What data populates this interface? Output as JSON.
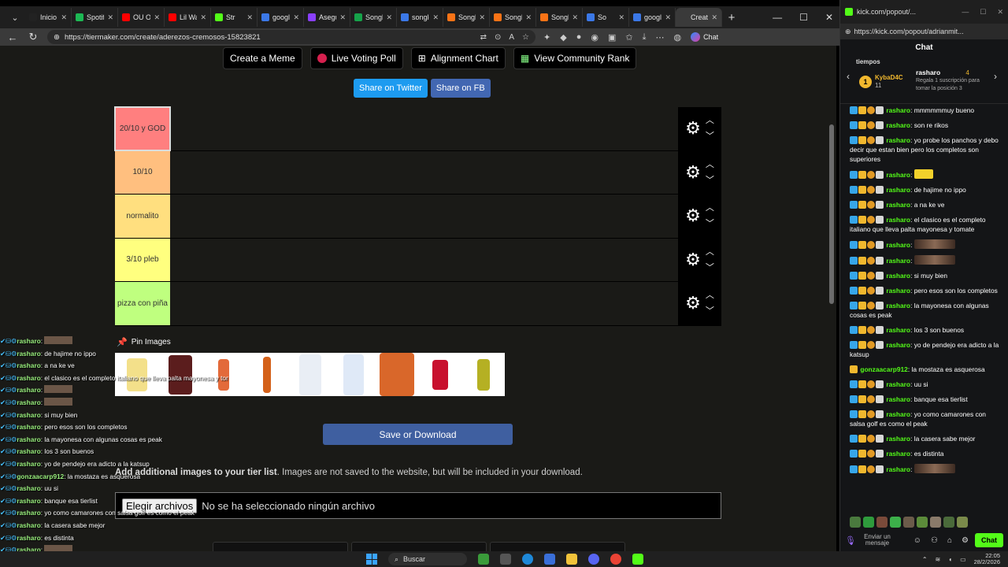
{
  "browser": {
    "tabs": [
      {
        "title": "Inicio /",
        "color": "#222222"
      },
      {
        "title": "Spotify",
        "color": "#1db954"
      },
      {
        "title": "OU OU",
        "color": "#ff0000"
      },
      {
        "title": "Lil Way",
        "color": "#ff0000"
      },
      {
        "title": "Str",
        "color": "#53fc18"
      },
      {
        "title": "google",
        "color": "#3b78e7"
      },
      {
        "title": "Asegur",
        "color": "#8a3ffc"
      },
      {
        "title": "Songle",
        "color": "#16a34a"
      },
      {
        "title": "songle",
        "color": "#3b78e7"
      },
      {
        "title": "Songle",
        "color": "#f97316"
      },
      {
        "title": "Songle",
        "color": "#f97316"
      },
      {
        "title": "Songle",
        "color": "#f97316"
      },
      {
        "title": "So",
        "color": "#3b78e7"
      },
      {
        "title": "google",
        "color": "#3b78e7"
      },
      {
        "title": "Create",
        "color": "#3a3a3a"
      }
    ],
    "url": "https://tiermaker.com/create/aderezos-cremosos-15823821",
    "copilot_label": "Chat"
  },
  "tiermaker": {
    "buttons": [
      "Create a Meme",
      "Live Voting Poll",
      "Alignment Chart",
      "View Community Rank"
    ],
    "share_twitter": "Share on Twitter",
    "share_fb": "Share on FB",
    "tiers": [
      {
        "label": "20/10 y GOD",
        "color": "#ff7f7f"
      },
      {
        "label": "10/10",
        "color": "#ffbf7f"
      },
      {
        "label": "normalito",
        "color": "#ffdf7f"
      },
      {
        "label": "3/10 pleb",
        "color": "#ffff7f"
      },
      {
        "label": "pizza con piña",
        "color": "#bfff7f"
      }
    ],
    "pin_images_label": "Pin Images",
    "save_button": "Save or Download",
    "add_note_bold": "Add additional images to your tier list",
    "add_note_rest": ". Images are not saved to the website, but will be included in your download.",
    "file_button": "Elegir archivos",
    "file_status": "No se ha seleccionado ningún archivo"
  },
  "overlay_chat": [
    {
      "user": "rasharo",
      "text": ""
    },
    {
      "user": "rasharo",
      "text": "de hajime no ippo"
    },
    {
      "user": "rasharo",
      "text": "a na ke ve"
    },
    {
      "user": "rasharo",
      "text": "el clasico es el completo italiano que lleva palta mayonesa y tomate"
    },
    {
      "user": "rasharo",
      "text": ""
    },
    {
      "user": "rasharo",
      "text": ""
    },
    {
      "user": "rasharo",
      "text": "si muy bien"
    },
    {
      "user": "rasharo",
      "text": "pero esos son los completos"
    },
    {
      "user": "rasharo",
      "text": "la mayonesa con algunas cosas es peak"
    },
    {
      "user": "rasharo",
      "text": "los 3 son buenos"
    },
    {
      "user": "rasharo",
      "text": "yo de pendejo era adicto a la katsup"
    },
    {
      "user": "gonzaacarp912",
      "text": "la mostaza es asquerosa"
    },
    {
      "user": "rasharo",
      "text": "uu si"
    },
    {
      "user": "rasharo",
      "text": "banque esa tierlist"
    },
    {
      "user": "rasharo",
      "text": "yo como camarones con salsa golf es como el peak"
    },
    {
      "user": "rasharo",
      "text": "la casera sabe mejor"
    },
    {
      "user": "rasharo",
      "text": "es distinta"
    },
    {
      "user": "rasharo",
      "text": ""
    }
  ],
  "kick": {
    "title": "kick.com/popout/...",
    "url": "https://kick.com/popout/adrianmit...",
    "header": "Chat",
    "pinned_top": "tiempos",
    "gifter": "KybaD4C",
    "gifter_count": "11",
    "pinned_user": "rasharo",
    "pinned_count": "4",
    "pinned_text": "Regala 1 suscripción para tomar la posición 3",
    "messages": [
      {
        "user": "rasharo",
        "text": "mmmmmmuy bueno",
        "emote": ""
      },
      {
        "user": "rasharo",
        "text": "son re rikos",
        "emote": ""
      },
      {
        "user": "rasharo",
        "text": "yo probe los panchos y debo decir que estan bien pero los completos son superiores",
        "emote": ""
      },
      {
        "user": "rasharo",
        "text": "",
        "emote": "car"
      },
      {
        "user": "rasharo",
        "text": "de hajime no ippo",
        "emote": ""
      },
      {
        "user": "rasharo",
        "text": "a na ke ve",
        "emote": ""
      },
      {
        "user": "rasharo",
        "text": "el clasico es el completo italiano que lleva palta mayonesa y tomate",
        "emote": ""
      },
      {
        "user": "rasharo",
        "text": "",
        "emote": "face"
      },
      {
        "user": "rasharo",
        "text": "",
        "emote": "face"
      },
      {
        "user": "rasharo",
        "text": "si muy bien",
        "emote": ""
      },
      {
        "user": "rasharo",
        "text": "pero esos son los completos",
        "emote": ""
      },
      {
        "user": "rasharo",
        "text": "la mayonesa con algunas cosas es peak",
        "emote": ""
      },
      {
        "user": "rasharo",
        "text": "los 3 son buenos",
        "emote": ""
      },
      {
        "user": "rasharo",
        "text": "yo de pendejo era adicto a la katsup",
        "emote": ""
      },
      {
        "user": "gonzaacarp912",
        "text": "la mostaza es asquerosa",
        "emote": ""
      },
      {
        "user": "rasharo",
        "text": "uu si",
        "emote": ""
      },
      {
        "user": "rasharo",
        "text": "banque esa tierlist",
        "emote": ""
      },
      {
        "user": "rasharo",
        "text": "yo como camarones con salsa golf es como el peak",
        "emote": ""
      },
      {
        "user": "rasharo",
        "text": "la casera sabe mejor",
        "emote": ""
      },
      {
        "user": "rasharo",
        "text": "es distinta",
        "emote": ""
      },
      {
        "user": "rasharo",
        "text": "",
        "emote": "face"
      }
    ],
    "send_placeholder": "Enviar un mensaje",
    "chat_button": "Chat"
  },
  "taskbar": {
    "search": "Buscar",
    "time": "22:05",
    "date": "28/2/2026"
  }
}
